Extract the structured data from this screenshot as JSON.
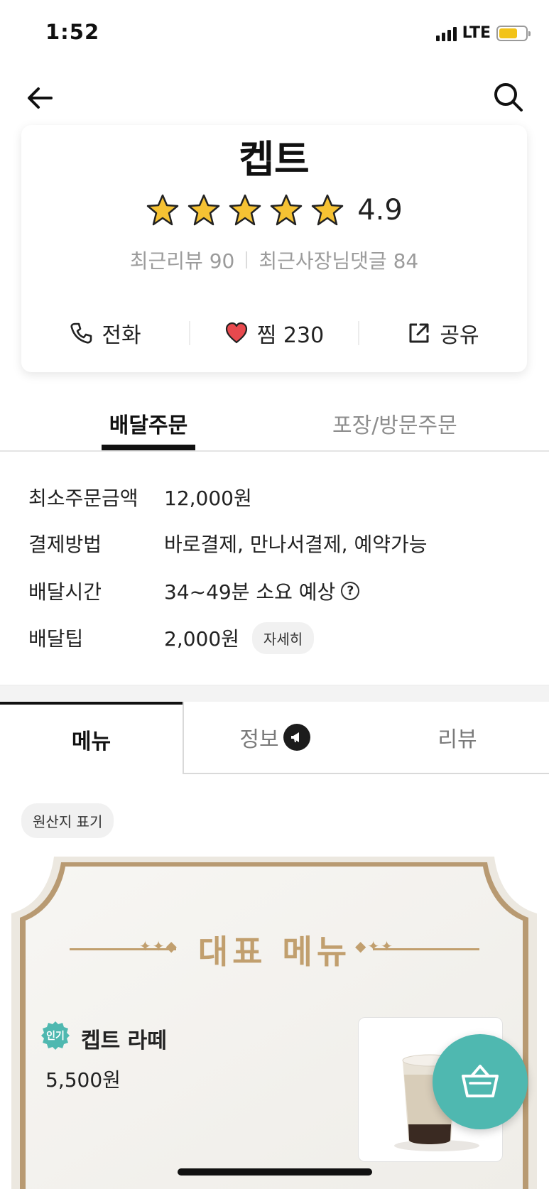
{
  "status_bar": {
    "time": "1:52",
    "network": "LTE",
    "battery_percent": 70
  },
  "nav": {
    "back_icon": "back-arrow-icon",
    "search_icon": "search-icon"
  },
  "store": {
    "name": "켑트",
    "rating": "4.9",
    "stars_filled": 5,
    "recent_reviews": "최근리뷰 90",
    "owner_comments": "최근사장님댓글 84"
  },
  "actions": {
    "call": "전화",
    "like": "찜 230",
    "share": "공유"
  },
  "order_tabs": {
    "delivery": "배달주문",
    "pickup": "포장/방문주문",
    "active": "delivery"
  },
  "info": {
    "min_order_label": "최소주문금액",
    "min_order_value": "12,000원",
    "payment_label": "결제방법",
    "payment_value": "바로결제, 만나서결제, 예약가능",
    "delivery_time_label": "배달시간",
    "delivery_time_value": "34~49분 소요 예상",
    "tip_label": "배달팁",
    "tip_value": "2,000원",
    "tip_detail": "자세히"
  },
  "menu_tabs": {
    "menu": "메뉴",
    "info": "정보",
    "review": "리뷰",
    "active": "menu"
  },
  "origin_label": "원산지 표기",
  "featured": {
    "title": "대표 메뉴",
    "item": {
      "badge": "인기",
      "name": "켑트 라떼",
      "price": "5,500원"
    }
  },
  "colors": {
    "accent": "#4fb8b0",
    "gold": "#c19f6e",
    "heart": "#e8494e",
    "star": "#f6c233"
  }
}
